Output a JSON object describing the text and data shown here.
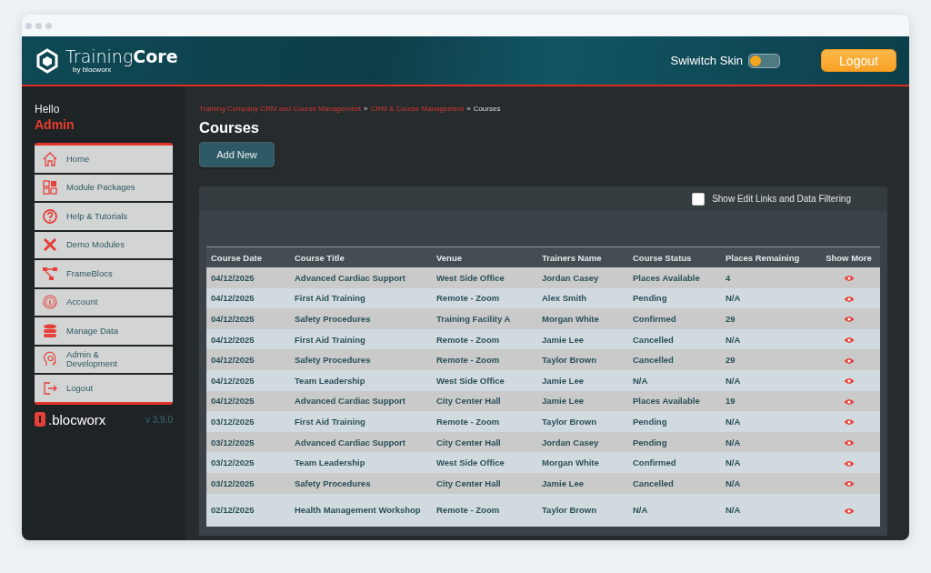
{
  "header": {
    "logo_name": "Training",
    "logo_bold": "Core",
    "logo_sub": "by blocworx",
    "skin_label": "Swiwitch Skin",
    "skin_switch": {
      "on": false
    },
    "logout": "Logout"
  },
  "sidebar": {
    "greeting": "Hello",
    "user": "Admin",
    "items": [
      {
        "label": "Home"
      },
      {
        "label": "Module Packages"
      },
      {
        "label": "Help & Tutorials"
      },
      {
        "label": "Demo Modules"
      },
      {
        "label": "FrameBlocs"
      },
      {
        "label": "Account"
      },
      {
        "label": "Manage Data"
      },
      {
        "label": "Admin & Development"
      },
      {
        "label": "Logout"
      }
    ],
    "brand": ".blocworx",
    "version": "v 3.9.0"
  },
  "breadcrumb": [
    {
      "label": "Training Company CRM and Course Management",
      "link": true
    },
    {
      "label": "CRM & Course Management",
      "link": true
    },
    {
      "label": "Courses",
      "link": false
    }
  ],
  "breadcrumb_separator": "»",
  "page_title": "Courses",
  "add_button": "Add New",
  "filter_option": {
    "label": "Show Edit Links and Data Filtering",
    "checked": false
  },
  "table": {
    "columns": [
      "Course Date",
      "Course Title",
      "Venue",
      "Trainers Name",
      "Course Status",
      "Places Remaining",
      "Show More"
    ],
    "rows": [
      [
        "04/12/2025",
        "Advanced Cardiac Support",
        "West Side Office",
        "Jordan Casey",
        "Places Available",
        "4"
      ],
      [
        "04/12/2025",
        "First Aid Training",
        "Remote - Zoom",
        "Alex Smith",
        "Pending",
        "N/A"
      ],
      [
        "04/12/2025",
        "Safety Procedures",
        "Training Facility A",
        "Morgan White",
        "Confirmed",
        "29"
      ],
      [
        "04/12/2025",
        "First Aid Training",
        "Remote - Zoom",
        "Jamie Lee",
        "Cancelled",
        "N/A"
      ],
      [
        "04/12/2025",
        "Safety Procedures",
        "Remote - Zoom",
        "Taylor Brown",
        "Cancelled",
        "29"
      ],
      [
        "04/12/2025",
        "Team Leadership",
        "West Side Office",
        "Jamie Lee",
        "N/A",
        "N/A"
      ],
      [
        "04/12/2025",
        "Advanced Cardiac Support",
        "City Center Hall",
        "Jamie Lee",
        "Places Available",
        "19"
      ],
      [
        "03/12/2025",
        "First Aid Training",
        "Remote - Zoom",
        "Taylor Brown",
        "Pending",
        "N/A"
      ],
      [
        "03/12/2025",
        "Advanced Cardiac Support",
        "City Center Hall",
        "Jordan Casey",
        "Pending",
        "N/A"
      ],
      [
        "03/12/2025",
        "Team Leadership",
        "West Side Office",
        "Morgan White",
        "Confirmed",
        "N/A"
      ],
      [
        "03/12/2025",
        "Safety Procedures",
        "City Center Hall",
        "Jamie Lee",
        "Cancelled",
        "N/A"
      ],
      [
        "02/12/2025",
        "Health Management Workshop",
        "Remote - Zoom",
        "Taylor Brown",
        "N/A",
        "N/A"
      ]
    ]
  }
}
